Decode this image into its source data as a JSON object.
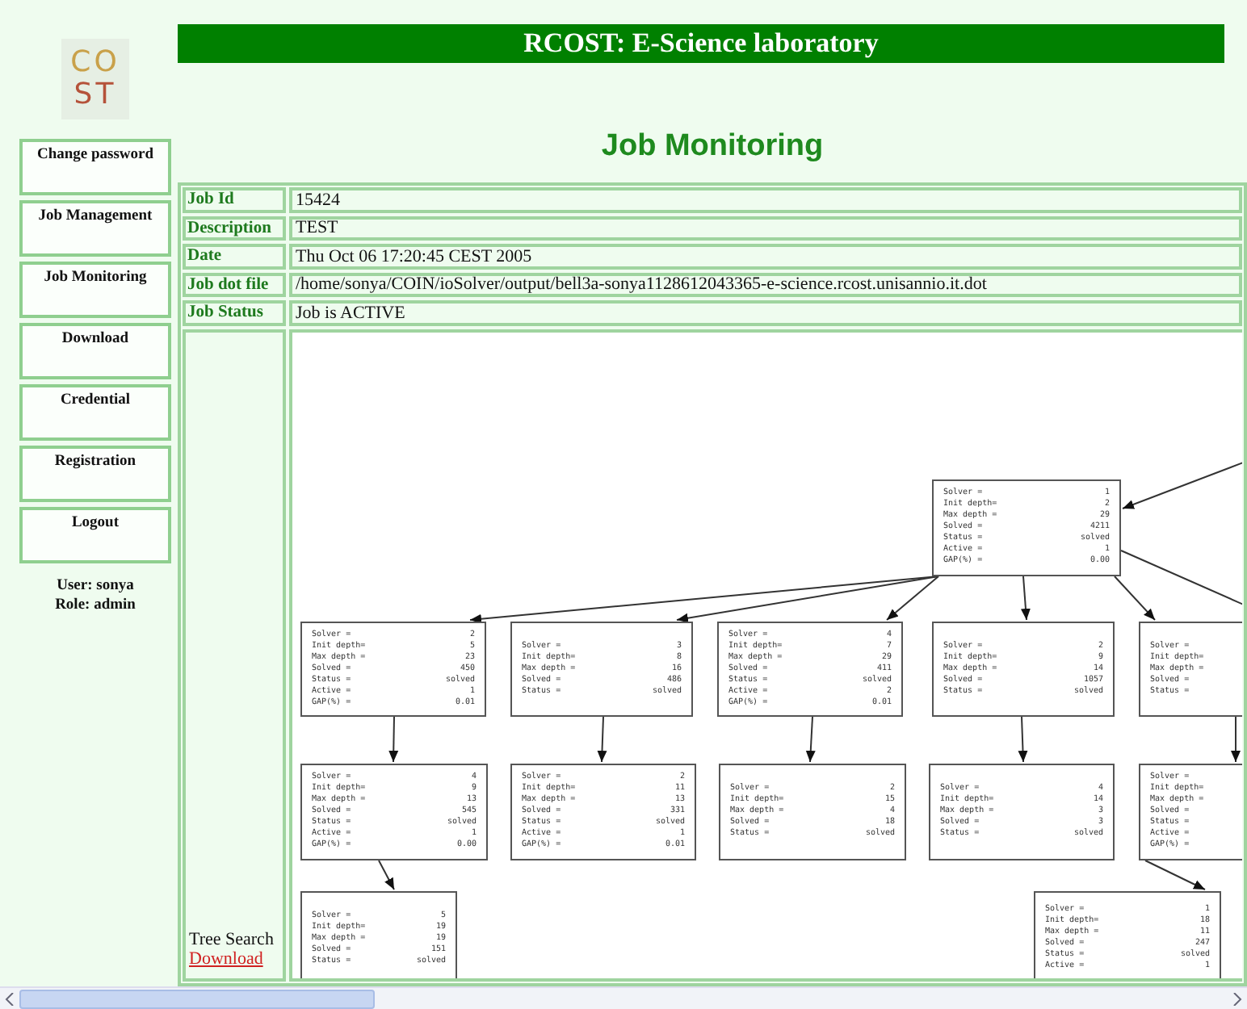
{
  "logo": {
    "top": "CO",
    "bottom": "ST"
  },
  "sidebar": {
    "items": [
      {
        "label": "Change password"
      },
      {
        "label": "Job Management"
      },
      {
        "label": "Job Monitoring"
      },
      {
        "label": "Download"
      },
      {
        "label": "Credential"
      },
      {
        "label": "Registration"
      },
      {
        "label": "Logout"
      }
    ],
    "user": "User: sonya",
    "role": "Role: admin"
  },
  "header": {
    "title": "RCOST: E-Science laboratory"
  },
  "page_title": "Job Monitoring",
  "details": [
    {
      "label": "Job Id",
      "value": "15424"
    },
    {
      "label": "Description",
      "value": "TEST"
    },
    {
      "label": "Date",
      "value": "Thu Oct 06 17:20:45 CEST 2005"
    },
    {
      "label": "Job dot file",
      "value": "/home/sonya/COIN/ioSolver/output/bell3a-sonya1128612043365-e-science.rcost.unisannio.it.dot"
    },
    {
      "label": "Job Status",
      "value": "Job is ACTIVE"
    }
  ],
  "tree": {
    "label": "Tree Search",
    "link": "Download",
    "has_parent_offscreen": true,
    "more_children_offscreen": true,
    "root": {
      "lines": [
        {
          "label": "Solver =",
          "value": "1"
        },
        {
          "label": "Init depth=",
          "value": "2"
        },
        {
          "label": "Max depth =",
          "value": "29"
        },
        {
          "label": "Solved =",
          "value": "4211"
        },
        {
          "label": "Status =",
          "value": "solved"
        },
        {
          "label": "Active =",
          "value": "1"
        },
        {
          "label": "GAP(%) =",
          "value": "0.00"
        }
      ],
      "children": [
        {
          "lines": [
            {
              "label": "Solver =",
              "value": "2"
            },
            {
              "label": "Init depth=",
              "value": "5"
            },
            {
              "label": "Max depth =",
              "value": "23"
            },
            {
              "label": "Solved =",
              "value": "450"
            },
            {
              "label": "Status =",
              "value": "solved"
            },
            {
              "label": "Active =",
              "value": "1"
            },
            {
              "label": "GAP(%) =",
              "value": "0.01"
            }
          ],
          "children": [
            {
              "lines": [
                {
                  "label": "Solver =",
                  "value": "4"
                },
                {
                  "label": "Init depth=",
                  "value": "9"
                },
                {
                  "label": "Max depth =",
                  "value": "13"
                },
                {
                  "label": "Solved =",
                  "value": "545"
                },
                {
                  "label": "Status =",
                  "value": "solved"
                },
                {
                  "label": "Active =",
                  "value": "1"
                },
                {
                  "label": "GAP(%) =",
                  "value": "0.00"
                }
              ],
              "children": [
                {
                  "lines": [
                    {
                      "label": "Solver =",
                      "value": "5"
                    },
                    {
                      "label": "Init depth=",
                      "value": "19"
                    },
                    {
                      "label": "Max depth =",
                      "value": "19"
                    },
                    {
                      "label": "Solved =",
                      "value": "151"
                    },
                    {
                      "label": "Status =",
                      "value": "solved"
                    }
                  ]
                }
              ]
            }
          ]
        },
        {
          "lines": [
            {
              "label": "Solver =",
              "value": "3"
            },
            {
              "label": "Init depth=",
              "value": "8"
            },
            {
              "label": "Max depth =",
              "value": "16"
            },
            {
              "label": "Solved =",
              "value": "486"
            },
            {
              "label": "Status =",
              "value": "solved"
            }
          ],
          "children": [
            {
              "lines": [
                {
                  "label": "Solver =",
                  "value": "2"
                },
                {
                  "label": "Init depth=",
                  "value": "11"
                },
                {
                  "label": "Max depth =",
                  "value": "13"
                },
                {
                  "label": "Solved =",
                  "value": "331"
                },
                {
                  "label": "Status =",
                  "value": "solved"
                },
                {
                  "label": "Active =",
                  "value": "1"
                },
                {
                  "label": "GAP(%) =",
                  "value": "0.01"
                }
              ]
            }
          ]
        },
        {
          "lines": [
            {
              "label": "Solver =",
              "value": "4"
            },
            {
              "label": "Init depth=",
              "value": "7"
            },
            {
              "label": "Max depth =",
              "value": "29"
            },
            {
              "label": "Solved =",
              "value": "411"
            },
            {
              "label": "Status =",
              "value": "solved"
            },
            {
              "label": "Active =",
              "value": "2"
            },
            {
              "label": "GAP(%) =",
              "value": "0.01"
            }
          ],
          "children": [
            {
              "lines": [
                {
                  "label": "Solver =",
                  "value": "2"
                },
                {
                  "label": "Init depth=",
                  "value": "15"
                },
                {
                  "label": "Max depth =",
                  "value": "4"
                },
                {
                  "label": "Solved =",
                  "value": "18"
                },
                {
                  "label": "Status =",
                  "value": "solved"
                }
              ]
            }
          ]
        },
        {
          "lines": [
            {
              "label": "Solver =",
              "value": "2"
            },
            {
              "label": "Init depth=",
              "value": "9"
            },
            {
              "label": "Max depth =",
              "value": "14"
            },
            {
              "label": "Solved =",
              "value": "1057"
            },
            {
              "label": "Status =",
              "value": "solved"
            }
          ],
          "children": [
            {
              "lines": [
                {
                  "label": "Solver =",
                  "value": "4"
                },
                {
                  "label": "Init depth=",
                  "value": "14"
                },
                {
                  "label": "Max depth =",
                  "value": "3"
                },
                {
                  "label": "Solved =",
                  "value": "3"
                },
                {
                  "label": "Status =",
                  "value": "solved"
                }
              ]
            }
          ]
        },
        {
          "lines": [
            {
              "label": "Solver ="
            },
            {
              "label": "Init depth="
            },
            {
              "label": "Max depth ="
            },
            {
              "label": "Solved ="
            },
            {
              "label": "Status ="
            }
          ],
          "children": [
            {
              "lines": [
                {
                  "label": "Solver ="
                },
                {
                  "label": "Init depth="
                },
                {
                  "label": "Max depth ="
                },
                {
                  "label": "Solved ="
                },
                {
                  "label": "Status ="
                },
                {
                  "label": "Active ="
                },
                {
                  "label": "GAP(%) ="
                }
              ],
              "children": [
                {
                  "lines": [
                    {
                      "label": "Solver =",
                      "value": "1"
                    },
                    {
                      "label": "Init depth=",
                      "value": "18"
                    },
                    {
                      "label": "Max depth =",
                      "value": "11"
                    },
                    {
                      "label": "Solved =",
                      "value": "247"
                    },
                    {
                      "label": "Status =",
                      "value": "solved"
                    },
                    {
                      "label": "Active =",
                      "value": "1"
                    }
                  ]
                }
              ]
            }
          ]
        }
      ]
    }
  }
}
